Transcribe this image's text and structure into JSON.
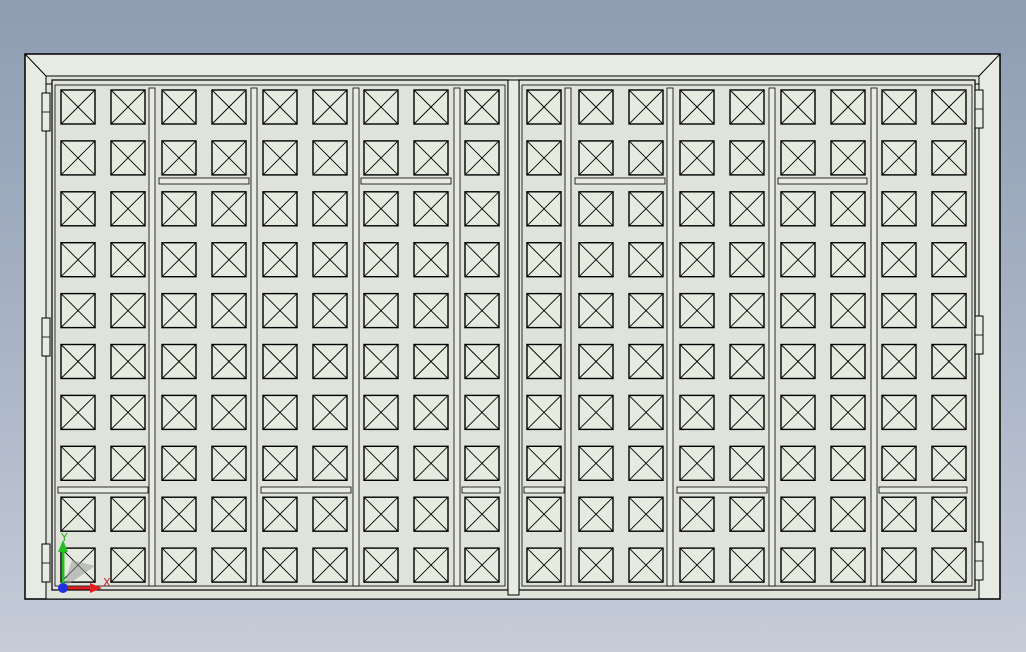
{
  "view": {
    "background_top": "#8e9db2",
    "background_bottom": "#c6ccd8",
    "frame_fill": "#e8ebe3",
    "panel_fill": "#dfe3da",
    "tile_fill": "#e6ebe0",
    "line_color": "#000000"
  },
  "door": {
    "leaves": 2,
    "columns_per_leaf": 9,
    "rows": 10
  },
  "triad": {
    "x_label": "X",
    "y_label": "Y",
    "x_color": "#e02020",
    "y_color": "#22c022",
    "origin_color": "#2030e0"
  }
}
